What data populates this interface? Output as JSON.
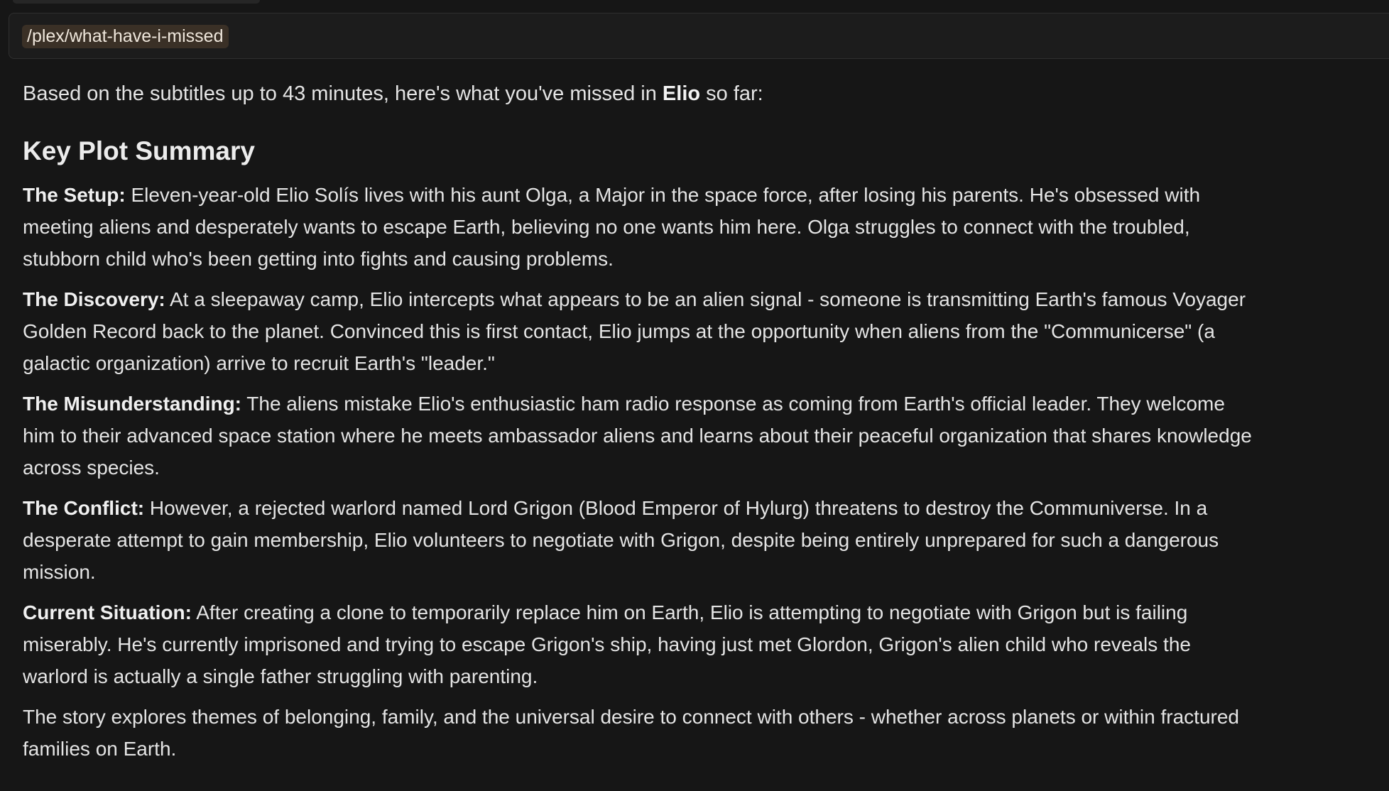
{
  "command": {
    "text": "/plex/what-have-i-missed"
  },
  "response": {
    "intro": {
      "prefix": "Based on the subtitles up to 43 minutes, here's what you've missed in ",
      "title": "Elio",
      "suffix": " so far:"
    },
    "heading": "Key Plot Summary",
    "paragraphs": [
      {
        "label": "The Setup:",
        "lines": [
          " Eleven-year-old Elio Solís lives with his aunt Olga, a Major in the space force, after losing his parents. He's obsessed with",
          "meeting aliens and desperately wants to escape Earth, believing no one wants him here. Olga struggles to connect with the troubled,",
          "stubborn child who's been getting into fights and causing problems."
        ]
      },
      {
        "label": "The Discovery:",
        "lines": [
          " At a sleepaway camp, Elio intercepts what appears to be an alien signal - someone is transmitting Earth's famous Voyager",
          "Golden Record back to the planet. Convinced this is first contact, Elio jumps at the opportunity when aliens from the \"Communicerse\" (a",
          "galactic organization) arrive to recruit Earth's \"leader.\""
        ]
      },
      {
        "label": "The Misunderstanding:",
        "lines": [
          " The aliens mistake Elio's enthusiastic ham radio response as coming from Earth's official leader. They welcome",
          "him to their advanced space station where he meets ambassador aliens and learns about their peaceful organization that shares knowledge",
          "across species."
        ]
      },
      {
        "label": "The Conflict:",
        "lines": [
          " However, a rejected warlord named Lord Grigon (Blood Emperor of Hylurg) threatens to destroy the Communiverse. In a",
          "desperate attempt to gain membership, Elio volunteers to negotiate with Grigon, despite being entirely unprepared for such a dangerous",
          "mission."
        ]
      },
      {
        "label": "Current Situation:",
        "lines": [
          " After creating a clone to temporarily replace him on Earth, Elio is attempting to negotiate with Grigon but is failing",
          "miserably. He's currently imprisoned and trying to escape Grigon's ship, having just met Glordon, Grigon's alien child who reveals the",
          "warlord is actually a single father struggling with parenting."
        ]
      }
    ],
    "closing": {
      "lines": [
        "The story explores themes of belonging, family, and the universal desire to connect with others - whether across planets or within fractured",
        "families on Earth."
      ]
    }
  }
}
